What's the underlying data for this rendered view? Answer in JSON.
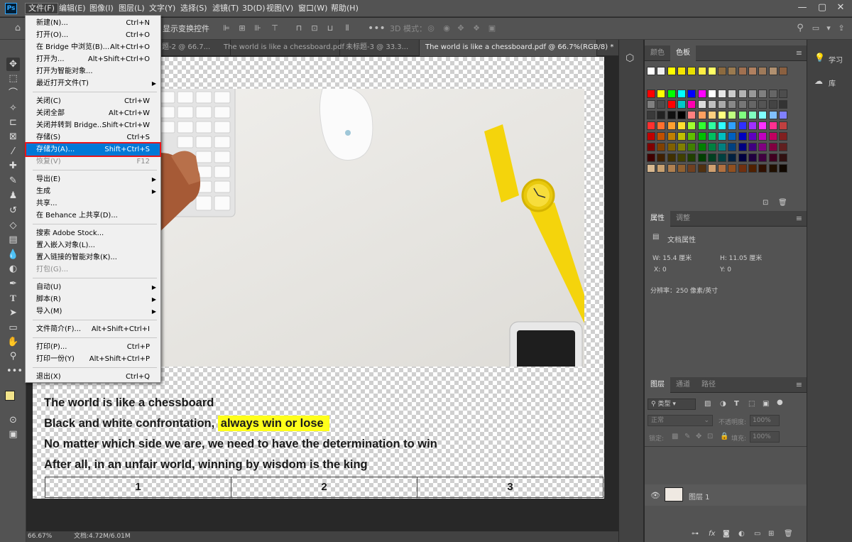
{
  "app": {
    "logo": "Ps"
  },
  "menubar": {
    "items": [
      {
        "label": "文件(F)",
        "active": true
      },
      {
        "label": "编辑(E)"
      },
      {
        "label": "图像(I)"
      },
      {
        "label": "图层(L)"
      },
      {
        "label": "文字(Y)"
      },
      {
        "label": "选择(S)"
      },
      {
        "label": "滤镜(T)"
      },
      {
        "label": "3D(D)"
      },
      {
        "label": "视图(V)"
      },
      {
        "label": "窗口(W)"
      },
      {
        "label": "帮助(H)"
      }
    ],
    "window_controls": [
      "—",
      "▢",
      "✕"
    ]
  },
  "options_bar": {
    "show_transform_label": "显示变换控件",
    "mode_3d_label": "3D 模式："
  },
  "tabs": [
    {
      "label": "题-2 @ 66.7...",
      "active": false
    },
    {
      "label": "The world is like a chessboard.pdf",
      "active": false
    },
    {
      "label": "未标题-3 @ 33.3...",
      "active": false
    },
    {
      "label": "The world is like a chessboard.pdf @ 66.7%(RGB/8) *",
      "active": true
    }
  ],
  "file_menu": {
    "items": [
      {
        "label": "新建(N)...",
        "shortcut": "Ctrl+N"
      },
      {
        "label": "打开(O)...",
        "shortcut": "Ctrl+O"
      },
      {
        "label": "在 Bridge 中浏览(B)...",
        "shortcut": "Alt+Ctrl+O"
      },
      {
        "label": "打开为...",
        "shortcut": "Alt+Shift+Ctrl+O"
      },
      {
        "label": "打开为智能对象..."
      },
      {
        "label": "最近打开文件(T)",
        "submenu": true
      },
      {
        "sep": true
      },
      {
        "label": "关闭(C)",
        "shortcut": "Ctrl+W"
      },
      {
        "label": "关闭全部",
        "shortcut": "Alt+Ctrl+W"
      },
      {
        "label": "关闭并转到 Bridge...",
        "shortcut": "Shift+Ctrl+W"
      },
      {
        "label": "存储(S)",
        "shortcut": "Ctrl+S"
      },
      {
        "label": "存储为(A)...",
        "shortcut": "Shift+Ctrl+S",
        "highlighted": true
      },
      {
        "label": "恢复(V)",
        "shortcut": "F12",
        "disabled": true
      },
      {
        "sep": true
      },
      {
        "label": "导出(E)",
        "submenu": true
      },
      {
        "label": "生成",
        "submenu": true
      },
      {
        "label": "共享..."
      },
      {
        "label": "在 Behance 上共享(D)..."
      },
      {
        "sep": true
      },
      {
        "label": "搜索 Adobe Stock..."
      },
      {
        "label": "置入嵌入对象(L)..."
      },
      {
        "label": "置入链接的智能对象(K)..."
      },
      {
        "label": "打包(G)...",
        "disabled": true
      },
      {
        "sep": true
      },
      {
        "label": "自动(U)",
        "submenu": true
      },
      {
        "label": "脚本(R)",
        "submenu": true
      },
      {
        "label": "导入(M)",
        "submenu": true
      },
      {
        "sep": true
      },
      {
        "label": "文件简介(F)...",
        "shortcut": "Alt+Shift+Ctrl+I"
      },
      {
        "sep": true
      },
      {
        "label": "打印(P)...",
        "shortcut": "Ctrl+P"
      },
      {
        "label": "打印一份(Y)",
        "shortcut": "Alt+Shift+Ctrl+P"
      },
      {
        "sep": true
      },
      {
        "label": "退出(X)",
        "shortcut": "Ctrl+Q"
      }
    ]
  },
  "document": {
    "lines": [
      "The world is like a chessboard",
      "Black and white confrontation, ",
      "No matter which side we are, we need to have the determination to win",
      "After all, in an unfair world, winning by wisdom is the king"
    ],
    "highlight": "always win or lose",
    "highlight_color": "#ffff1a",
    "table_cells": [
      "1",
      "2",
      "3"
    ]
  },
  "status": {
    "zoom": "66.67%",
    "doc": "文档:4.72M/6.01M"
  },
  "swatches_panel": {
    "tabs": [
      "颜色",
      "色板"
    ],
    "active_tab": "色板"
  },
  "properties_panel": {
    "tabs": [
      "属性",
      "调整"
    ],
    "section": "文档属性",
    "w": "W:  15.4 厘米",
    "h": "H:  11.05 厘米",
    "x": "X:  0",
    "y": "Y:  0",
    "resolution": "分辨率：250 像素/英寸"
  },
  "layers_panel": {
    "tabs": [
      "图层",
      "通道",
      "路径"
    ],
    "filter": "类型",
    "blend": "正常",
    "opacity_label": "不透明度:",
    "opacity": "100%",
    "lock_label": "锁定:",
    "fill_label": "填充:",
    "fill": "100%",
    "layer_name": "图层 1"
  },
  "far_right": {
    "learn": "学习",
    "library": "库"
  }
}
